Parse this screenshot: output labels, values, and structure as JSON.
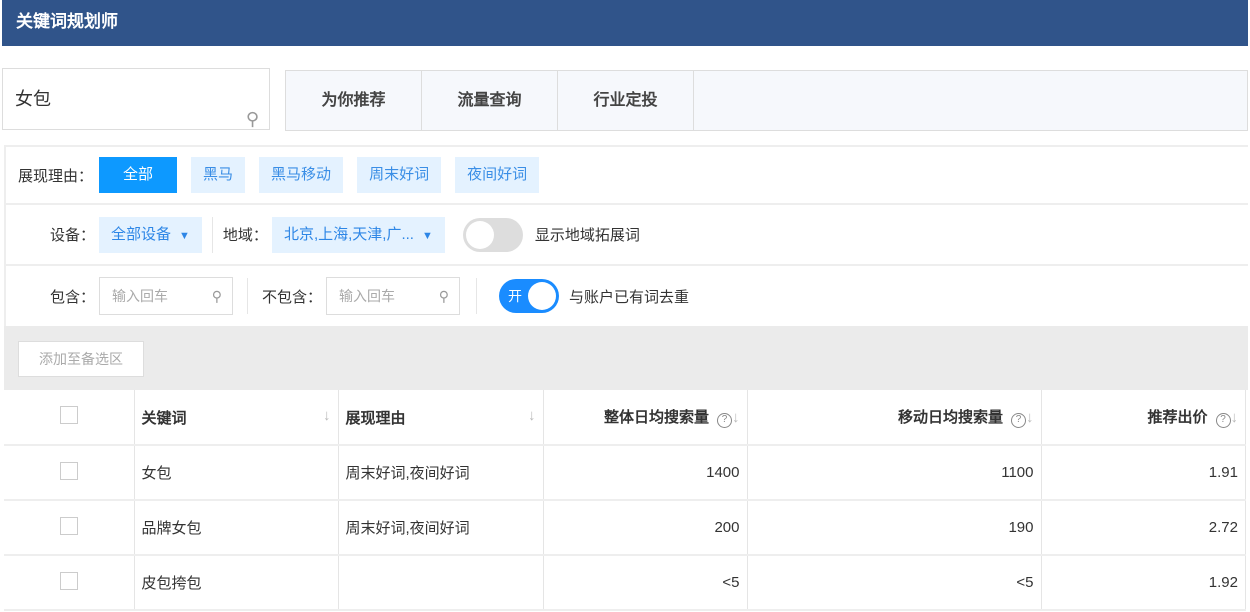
{
  "app": {
    "title": "关键词规划师"
  },
  "search": {
    "value": "女包"
  },
  "tabs": [
    "为你推荐",
    "流量查询",
    "行业定投"
  ],
  "filters": {
    "reason_label": "展现理由：",
    "reasons": [
      "全部",
      "黑马",
      "黑马移动",
      "周末好词",
      "夜间好词"
    ],
    "device_label": "设备：",
    "device_value": "全部设备",
    "region_label": "地域：",
    "region_value": "北京,上海,天津,广...",
    "show_region_toggle_label": "显示地域拓展词",
    "include_label": "包含：",
    "include_placeholder": "输入回车",
    "exclude_label": "不包含：",
    "exclude_placeholder": "输入回车",
    "dedupe_toggle_text": "开",
    "dedupe_label": "与账户已有词去重"
  },
  "toolbar": {
    "add_button": "添加至备选区"
  },
  "table": {
    "headers": [
      "关键词",
      "展现理由",
      "整体日均搜索量",
      "移动日均搜索量",
      "推荐出价"
    ],
    "rows": [
      {
        "keyword": "女包",
        "reason": "周末好词,夜间好词",
        "total": "1400",
        "mobile": "1100",
        "bid": "1.91"
      },
      {
        "keyword": "品牌女包",
        "reason": "周末好词,夜间好词",
        "total": "200",
        "mobile": "190",
        "bid": "2.72"
      },
      {
        "keyword": "皮包挎包",
        "reason": "",
        "total": "<5",
        "mobile": "<5",
        "bid": "1.92"
      }
    ]
  }
}
